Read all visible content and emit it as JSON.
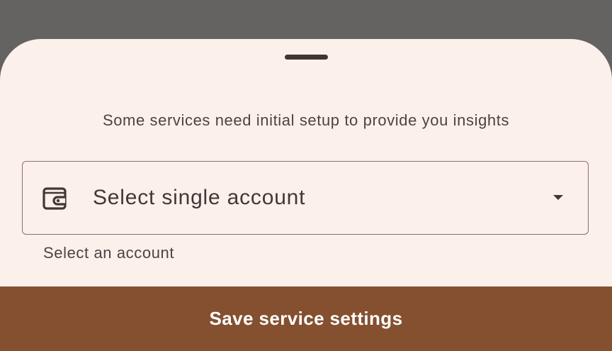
{
  "sheet": {
    "subtitle": "Some services need initial setup to provide you insights",
    "account_select": {
      "icon": "wallet-icon",
      "value": "Select single account",
      "dropdown_icon": "arrow-drop-down-icon",
      "helper_text": "Select an account"
    },
    "save_button_label": "Save service settings"
  },
  "colors": {
    "scrim": "#656262",
    "sheet_background": "#fcf0eb",
    "accent_button": "#845030",
    "text_primary": "#413836",
    "outline": "#857371"
  }
}
